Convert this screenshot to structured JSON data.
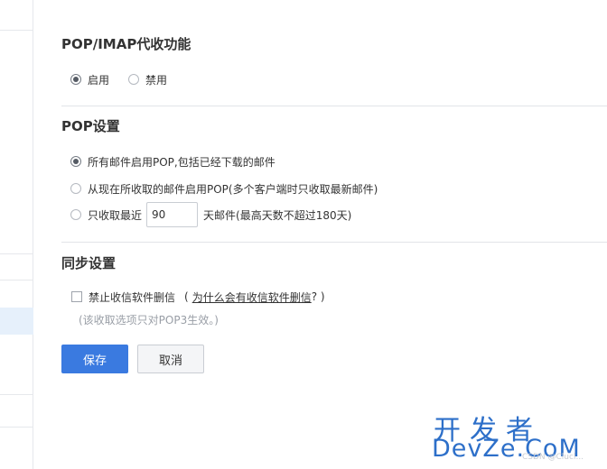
{
  "pop_imap": {
    "title": "POP/IMAP代收功能",
    "options": [
      {
        "label": "启用",
        "checked": true
      },
      {
        "label": "禁用",
        "checked": false
      }
    ]
  },
  "pop_settings": {
    "title": "POP设置",
    "options": [
      {
        "label": "所有邮件启用POP,包括已经下载的邮件",
        "checked": true
      },
      {
        "label": "从现在所收取的邮件启用POP(多个客户端时只收取最新邮件)",
        "checked": false
      },
      {
        "label": "只收取最近",
        "checked": false
      }
    ],
    "days_value": "90",
    "days_suffix": "天邮件(最高天数不超过180天)"
  },
  "sync": {
    "title": "同步设置",
    "checkbox_label": "禁止收信软件删信",
    "paren_open": "(",
    "link_text": "为什么会有收信软件删信",
    "paren_close": "? )",
    "checked": false,
    "hint": "(该收取选项只对POP3生效。)"
  },
  "buttons": {
    "save": "保存",
    "cancel": "取消"
  },
  "watermark": {
    "cn": "开发者",
    "en": "DevZe.CoM",
    "small": "CSDN @Clucl..."
  },
  "colors": {
    "primary": "#3a7ae0",
    "watermark": "#2d6fc9"
  }
}
